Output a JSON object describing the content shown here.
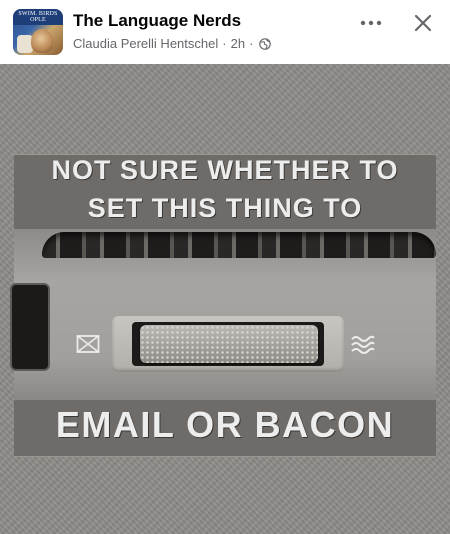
{
  "header": {
    "page_name": "The Language Nerds",
    "author": "Claudia Perelli Hentschel",
    "separator": "·",
    "time": "2h",
    "audience_icon": "globe-icon",
    "more_icon": "more-horizontal-icon",
    "close_icon": "close-icon",
    "avatar_text": "SWIM. BIRDS OPLE"
  },
  "post_image": {
    "caption_top_line1": "NOT SURE WHETHER TO",
    "caption_top_line2": "SET THIS THING TO",
    "caption_bottom": "EMAIL OR BACON",
    "left_symbol": "envelope-icon",
    "right_symbol": "waves-icon"
  },
  "colors": {
    "title_text": "#050505",
    "meta_text": "#65676b",
    "caption_text": "#ededed",
    "caption_band": "#6f6b68",
    "background_texture": "#8e8b88"
  }
}
